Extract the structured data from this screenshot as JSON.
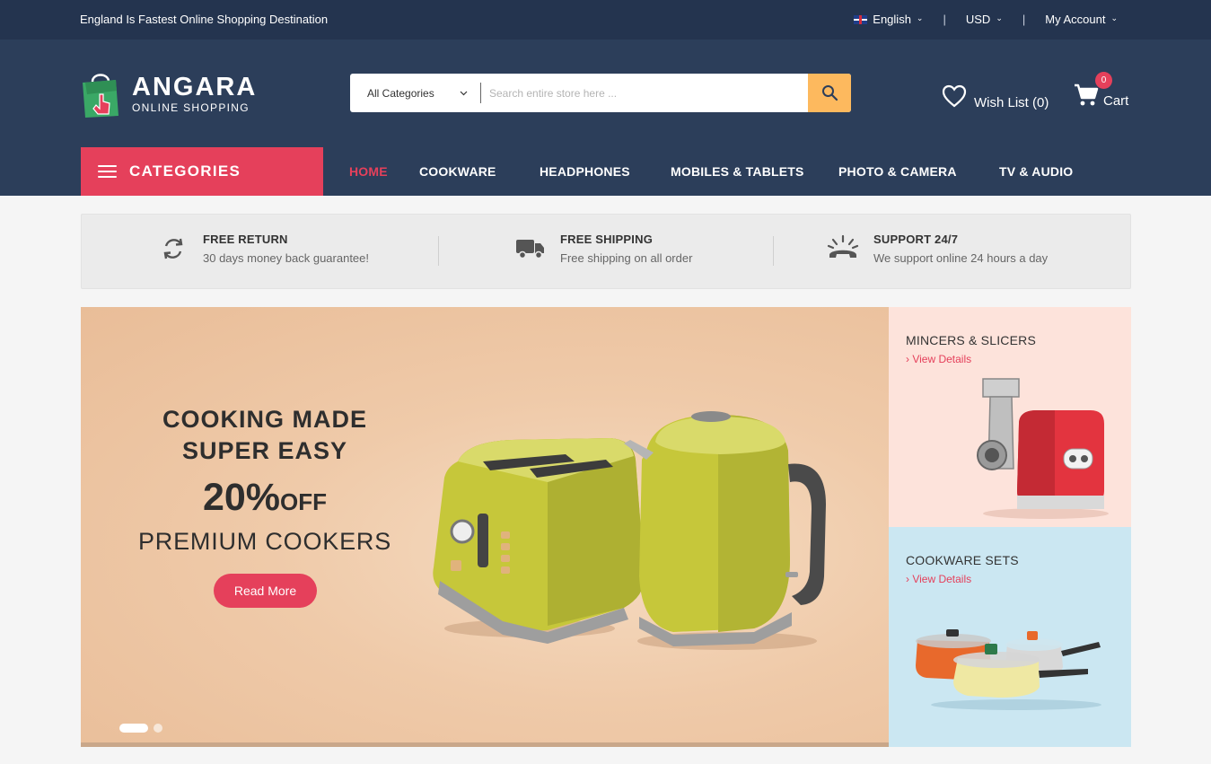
{
  "topbar": {
    "tagline": "England Is Fastest Online Shopping Destination",
    "language": "English",
    "currency": "USD",
    "account": "My Account",
    "chevron": "⌄",
    "separator": "|"
  },
  "brand": {
    "name": "ANGARA",
    "sub": "ONLINE SHOPPING"
  },
  "search": {
    "category": "All Categories",
    "placeholder": "Search entire store here ..."
  },
  "wishlist": {
    "label": "Wish List (0)"
  },
  "cart": {
    "label": "Cart",
    "count": "0"
  },
  "categories_button": "CATEGORIES",
  "nav": {
    "items": [
      {
        "label": "HOME"
      },
      {
        "label": "COOKWARE"
      },
      {
        "label": "HEADPHONES"
      },
      {
        "label": "MOBILES & TABLETS"
      },
      {
        "label": "PHOTO & CAMERA"
      },
      {
        "label": "TV & AUDIO"
      }
    ]
  },
  "features": [
    {
      "title": "FREE RETURN",
      "desc": "30 days money back guarantee!",
      "icon": "refresh-icon"
    },
    {
      "title": "FREE SHIPPING",
      "desc": "Free shipping on all order",
      "icon": "truck-icon"
    },
    {
      "title": "SUPPORT 24/7",
      "desc": "We support online 24 hours a day",
      "icon": "phone-icon"
    }
  ],
  "hero": {
    "line1": "COOKING MADE",
    "line2": "SUPER EASY",
    "percent": "20%",
    "off": "OFF",
    "line4": "PREMIUM COOKERS",
    "button": "Read More"
  },
  "side_banners": [
    {
      "title": "MINCERS & SLICERS",
      "link": "› View Details"
    },
    {
      "title": "COOKWARE SETS",
      "link": "› View Details"
    }
  ],
  "colors": {
    "accent": "#e5405b",
    "header": "#2c3e5a",
    "topbar": "#24344f",
    "search_button": "#fdb95e"
  }
}
